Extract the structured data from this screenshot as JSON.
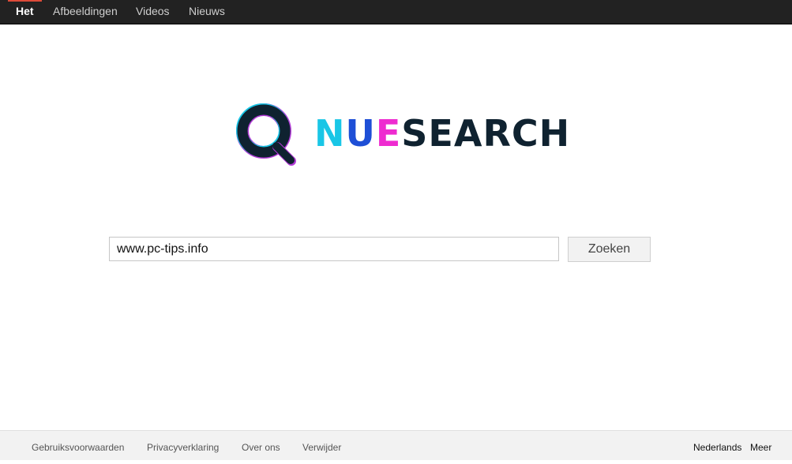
{
  "nav": {
    "tabs": [
      {
        "label": "Het",
        "active": true
      },
      {
        "label": "Afbeeldingen",
        "active": false
      },
      {
        "label": "Videos",
        "active": false
      },
      {
        "label": "Nieuws",
        "active": false
      }
    ]
  },
  "logo": {
    "parts": [
      "N",
      "U",
      "E",
      "SEARCH"
    ],
    "colors": {
      "n": "#19c6e6",
      "u": "#1e4fd6",
      "e": "#ee2bd0",
      "search": "#0f2230",
      "icon_ring": "#0f2230",
      "icon_outline_a": "#19c6e6",
      "icon_outline_b": "#b23bd6"
    },
    "icon": "magnifier-icon"
  },
  "search": {
    "value": "www.pc-tips.info",
    "button_label": "Zoeken"
  },
  "footer": {
    "links": [
      "Gebruiksvoorwaarden",
      "Privacyverklaring",
      "Over ons",
      "Verwijder"
    ],
    "right": [
      "Nederlands",
      "Meer"
    ]
  },
  "colors": {
    "topbar": "#222222",
    "active_tab_marker": "#dd4b39",
    "footer_bg": "#f2f2f2"
  }
}
